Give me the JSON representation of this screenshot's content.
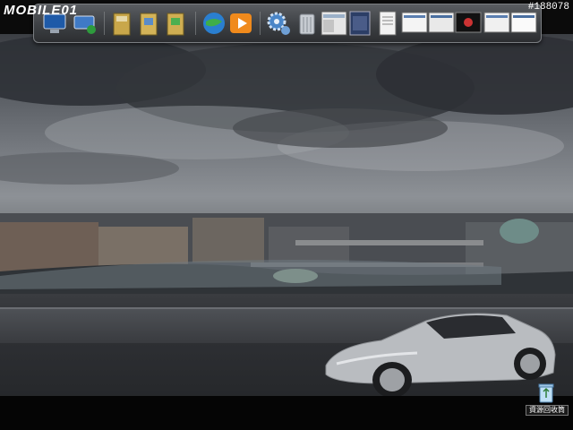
{
  "watermark": {
    "brand": "MOBILE01",
    "post_id": "#188078"
  },
  "dock": {
    "items": [
      {
        "name": "my-computer-icon"
      },
      {
        "name": "network-icon"
      },
      {
        "name": "folder-icon"
      },
      {
        "name": "pictures-folder-icon"
      },
      {
        "name": "music-folder-icon"
      },
      {
        "name": "internet-explorer-icon"
      },
      {
        "name": "media-player-icon"
      },
      {
        "name": "settings-gear-icon"
      },
      {
        "name": "trash-bin-icon"
      },
      {
        "name": "window-thumbnail"
      },
      {
        "name": "window-thumbnail"
      },
      {
        "name": "document-icon"
      },
      {
        "name": "window-thumbnail"
      },
      {
        "name": "window-thumbnail"
      },
      {
        "name": "window-thumbnail"
      },
      {
        "name": "window-thumbnail"
      }
    ]
  },
  "desktop": {
    "recycle_bin_label": "資源回收筒"
  }
}
